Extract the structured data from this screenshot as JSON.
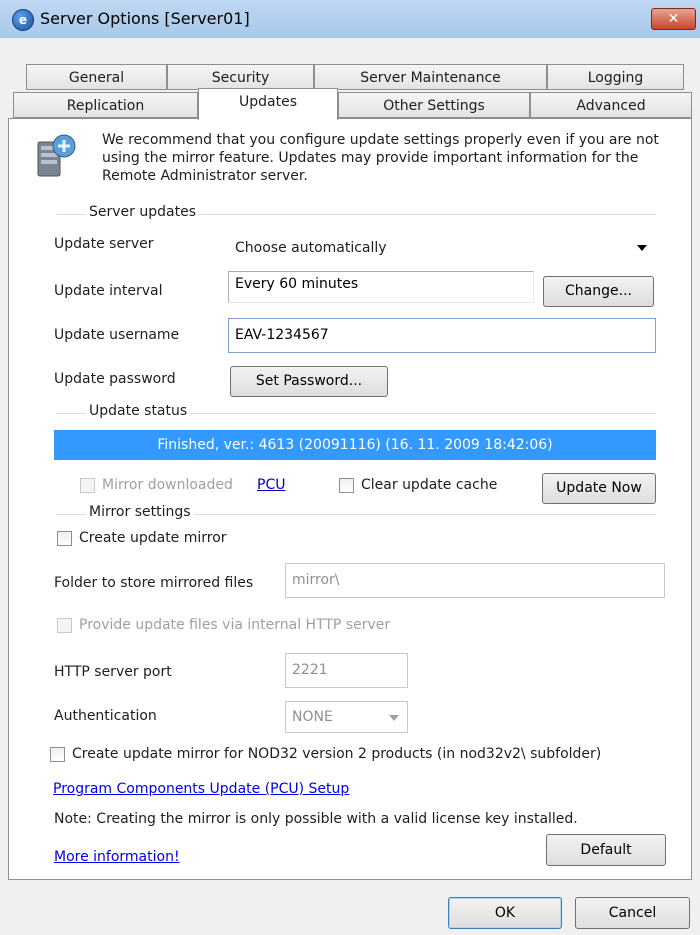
{
  "window": {
    "title": "Server Options [Server01]",
    "app_icon": "ra-app-icon",
    "close_label": "✕"
  },
  "tabs": {
    "row1": [
      "General",
      "Security",
      "Server Maintenance",
      "Logging"
    ],
    "row2": [
      "Replication",
      "Updates",
      "Other Settings",
      "Advanced"
    ],
    "active": "Updates"
  },
  "info": {
    "text": "We recommend that you configure update settings properly even if you are not using the mirror feature. Updates may provide important information for the Remote Administrator server."
  },
  "server_updates": {
    "group_label": "Server updates",
    "update_server_label": "Update server",
    "update_server_value": "Choose automatically",
    "update_interval_label": "Update interval",
    "update_interval_value": "Every 60 minutes",
    "change_button": "Change...",
    "update_username_label": "Update username",
    "update_username_value": "EAV-1234567",
    "update_password_label": "Update password",
    "set_password_button": "Set Password..."
  },
  "update_status": {
    "group_label": "Update status",
    "status_text": "Finished, ver.: 4613 (20091116)  (16. 11. 2009 18:42:06)",
    "mirror_downloaded_label": "Mirror downloaded",
    "pcu_link": "PCU",
    "clear_cache_label": "Clear update cache",
    "update_now_button": "Update Now"
  },
  "mirror_settings": {
    "group_label": "Mirror settings",
    "create_mirror_label": "Create update mirror",
    "folder_label": "Folder to store mirrored files",
    "folder_value": "mirror\\",
    "http_server_label": "Provide update files via internal HTTP server",
    "http_port_label": "HTTP server port",
    "http_port_value": "2221",
    "authentication_label": "Authentication",
    "authentication_value": "NONE",
    "nod32v2_label": "Create update mirror for NOD32 version 2 products (in nod32v2\\ subfolder)"
  },
  "footer": {
    "pcu_setup_link": "Program Components Update (PCU) Setup",
    "note": "Note: Creating the mirror is only possible with a valid license key installed.",
    "more_info_link": "More information!",
    "default_button": "Default",
    "ok_button": "OK",
    "cancel_button": "Cancel"
  },
  "colors": {
    "status_highlight": "#3399ff",
    "link": "#0000ee"
  }
}
